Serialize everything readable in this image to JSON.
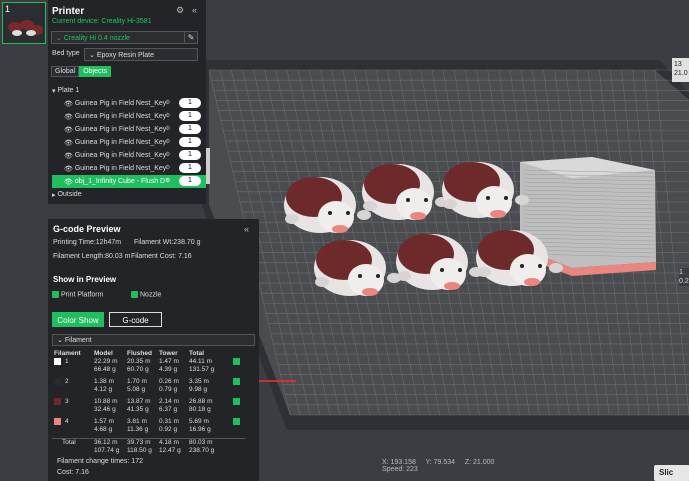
{
  "plate_thumb": {
    "number": "1"
  },
  "printer": {
    "title": "Printer",
    "current_device": "Current device: Creality Hi-3581",
    "nozzle": "Creality Hi 0.4 nozzle",
    "bed_type_label": "Bed type",
    "bed_type_value": "Epoxy Resin Plate",
    "tabs": [
      "Global",
      "Objects"
    ]
  },
  "object_tree": {
    "plate": "Plate 1",
    "objects": [
      {
        "name": "Guinea Pig in Field Nest_Key",
        "count": "1"
      },
      {
        "name": "Guinea Pig in Field Nest_Key",
        "count": "1"
      },
      {
        "name": "Guinea Pig in Field Nest_Key",
        "count": "1"
      },
      {
        "name": "Guinea Pig in Field Nest_Key",
        "count": "1"
      },
      {
        "name": "Guinea Pig in Field Nest_Key",
        "count": "1"
      },
      {
        "name": "Guinea Pig in Field Nest_Key",
        "count": "1"
      },
      {
        "name": "obj_1_Infinity Cube - Flush D",
        "count": "1"
      }
    ],
    "outside": "Outside"
  },
  "gcode": {
    "title": "G-code Preview",
    "printing_time": "Printing Time:12h47m",
    "filament_wt": "Filament Wt:238.70 g",
    "filament_length": "Filament Length:80.03 m",
    "filament_cost": "Filament Cost: 7.16",
    "show_in_preview": "Show in Preview",
    "print_platform": "Print Platform",
    "nozzle": "Nozzle",
    "color_show": "Color Show",
    "gcode_button": "G-code",
    "filament_select": "Filament",
    "table": {
      "headers": [
        "Filament",
        "Model",
        "Flushed",
        "Tower",
        "Total"
      ],
      "rows": [
        {
          "id": "1",
          "color": "#ffffff",
          "model": [
            "22.29 m",
            "66.48 g"
          ],
          "flushed": [
            "20.35 m",
            "60.70 g"
          ],
          "tower": [
            "1.47 m",
            "4.39 g"
          ],
          "total": [
            "44.11 m",
            "131.57 g"
          ]
        },
        {
          "id": "2",
          "color": "#2a2a2a",
          "model": [
            "1.38 m",
            "4.12 g"
          ],
          "flushed": [
            "1.70 m",
            "5.08 g"
          ],
          "tower": [
            "0.26 m",
            "0.79 g"
          ],
          "total": [
            "3.35 m",
            "9.98 g"
          ]
        },
        {
          "id": "3",
          "color": "#6e2a2a",
          "model": [
            "10.88 m",
            "32.46 g"
          ],
          "flushed": [
            "13.87 m",
            "41.35 g"
          ],
          "tower": [
            "2.14 m",
            "6.37 g"
          ],
          "total": [
            "26.88 m",
            "80.18 g"
          ]
        },
        {
          "id": "4",
          "color": "#e8867f",
          "model": [
            "1.57 m",
            "4.68 g"
          ],
          "flushed": [
            "3.81 m",
            "11.36 g"
          ],
          "tower": [
            "0.31 m",
            "0.92 g"
          ],
          "total": [
            "5.69 m",
            "16.96 g"
          ]
        }
      ],
      "total": {
        "label": "Total",
        "model": [
          "36.12 m",
          "107.74 g"
        ],
        "flushed": [
          "39.73 m",
          "118.50 g"
        ],
        "tower": [
          "4.18 m",
          "12.47 g"
        ],
        "total": [
          "80.03 m",
          "238.70 g"
        ]
      }
    },
    "change_times": "Filament change times:  172",
    "cost": "Cost:  7.16"
  },
  "status": {
    "x": "X: 193.158",
    "y": "Y: 79.534",
    "z": "Z: 21.000",
    "speed": "Speed: 223"
  },
  "slice_button": "Slic",
  "right_readout": [
    "13",
    "21.0"
  ],
  "right_readout2": [
    "1",
    "0.2"
  ],
  "colors": {
    "accent": "#1fbf5f",
    "plate": "#4a4c50",
    "grid": "#6a6c70"
  }
}
